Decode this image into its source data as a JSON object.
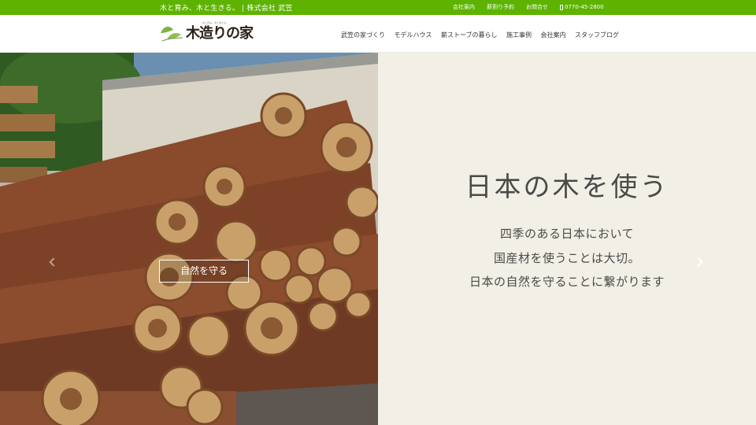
{
  "topbar": {
    "tagline": "木と育み、木と生きる。 | 株式会社 武笠",
    "links": [
      "会社案内",
      "薪割り予約",
      "お問合せ"
    ],
    "phone": "0770-45-2800"
  },
  "header": {
    "logo_text": "木造りの家",
    "logo_sub": "木と育み、木と生きる。",
    "nav": [
      "武笠の家づくり",
      "モデルハウス",
      "薪ストーブの暮らし",
      "施工事例",
      "会社案内",
      "スタッフブログ"
    ]
  },
  "hero": {
    "button_label": "自然を守る",
    "headline": "日本の木を使う",
    "copy": [
      "四季のある日本において",
      "国産材を使うことは大切。",
      "日本の自然を守ることに繋がります"
    ]
  },
  "colors": {
    "topbar": "#5db300",
    "panel": "#f2efe6",
    "text": "#4a4a48"
  },
  "icons": {
    "phone": "phone-icon",
    "logo": "leaf-logo-icon",
    "next": "chevron-right-icon"
  }
}
